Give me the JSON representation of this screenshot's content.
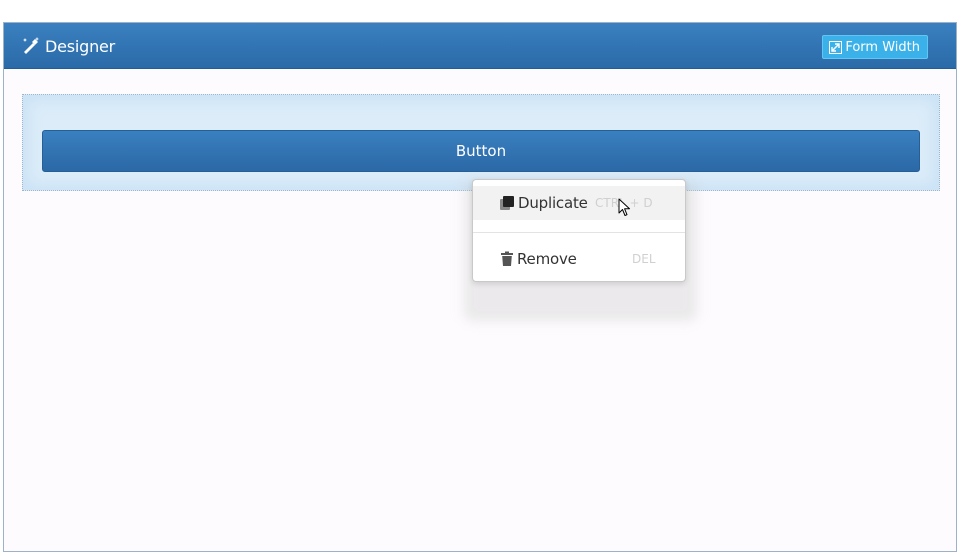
{
  "header": {
    "title": "Designer",
    "title_icon": "magic-wand-icon",
    "form_width_label": "Form Width",
    "form_width_icon": "expand-icon"
  },
  "canvas": {
    "button_label": "Button"
  },
  "context_menu": {
    "items": [
      {
        "label": "Duplicate",
        "shortcut": "CTRL + D",
        "icon": "copy-icon",
        "hovered": true
      },
      {
        "label": "Remove",
        "shortcut": "DEL",
        "icon": "trash-icon",
        "hovered": false
      }
    ]
  },
  "colors": {
    "header_blue": "#2f73b3",
    "button_blue": "#2b6aa8",
    "form_width_accent": "#3bb1ea",
    "selection_bg": "#dcecf9",
    "panel_bg": "#fdfbfd"
  }
}
